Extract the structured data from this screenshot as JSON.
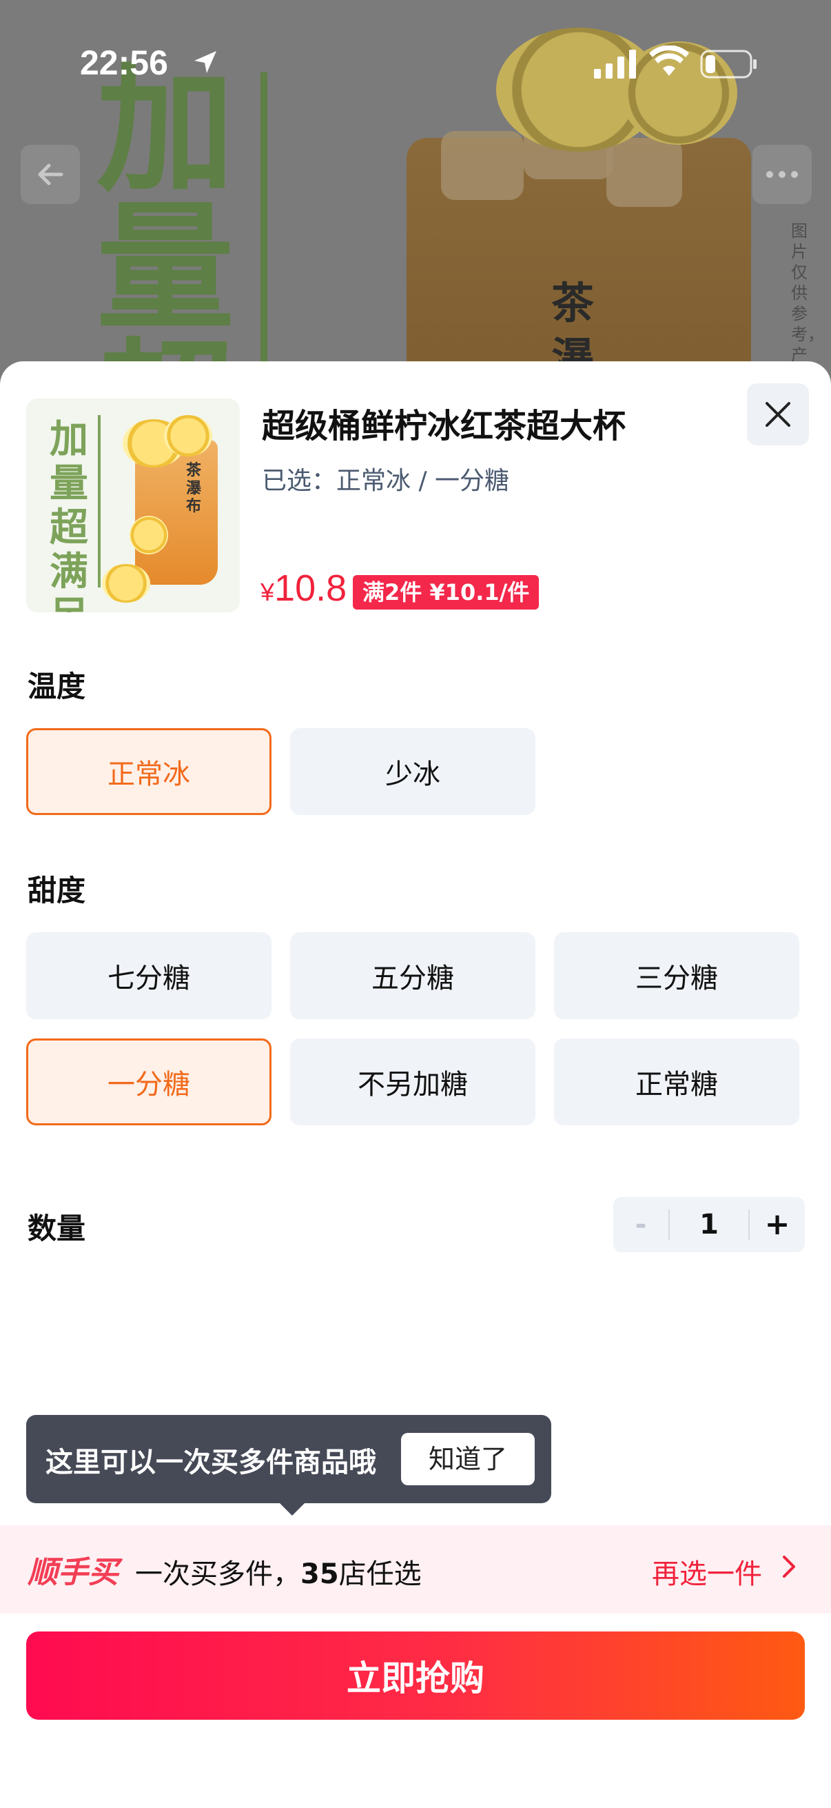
{
  "status_bar": {
    "time": "22:56"
  },
  "background": {
    "banner_text": [
      "加",
      "量",
      "超"
    ],
    "cup_text": [
      "茶",
      "瀑"
    ],
    "note": "图片仅供参考，产"
  },
  "product": {
    "image_text": [
      "加",
      "量",
      "超",
      "满",
      "足"
    ],
    "image_cup_text": "茶瀑布",
    "title": "超级桶鲜柠冰红茶超大杯",
    "selected": "已选：正常冰 / 一分糖",
    "price_currency": "¥",
    "price": "10.8",
    "deal": "满2件 ¥10.1/件"
  },
  "temperature": {
    "title": "温度",
    "options": [
      "正常冰",
      "少冰"
    ],
    "selected_index": 0
  },
  "sweetness": {
    "title": "甜度",
    "options": [
      "七分糖",
      "五分糖",
      "三分糖",
      "一分糖",
      "不另加糖",
      "正常糖"
    ],
    "selected_index": 3
  },
  "quantity": {
    "label": "数量",
    "minus": "-",
    "value": "1",
    "plus": "+"
  },
  "tooltip": {
    "text": "这里可以一次买多件商品哦",
    "button": "知道了"
  },
  "promo": {
    "brand": "顺手买",
    "text_prefix": "一次买多件，",
    "count": "35",
    "text_suffix": "店任选",
    "link": "再选一件"
  },
  "buy_button": "立即抢购",
  "colors": {
    "accent": "#f0233c",
    "selected_orange": "#f26a1a",
    "option_bg": "#f0f3f7"
  }
}
